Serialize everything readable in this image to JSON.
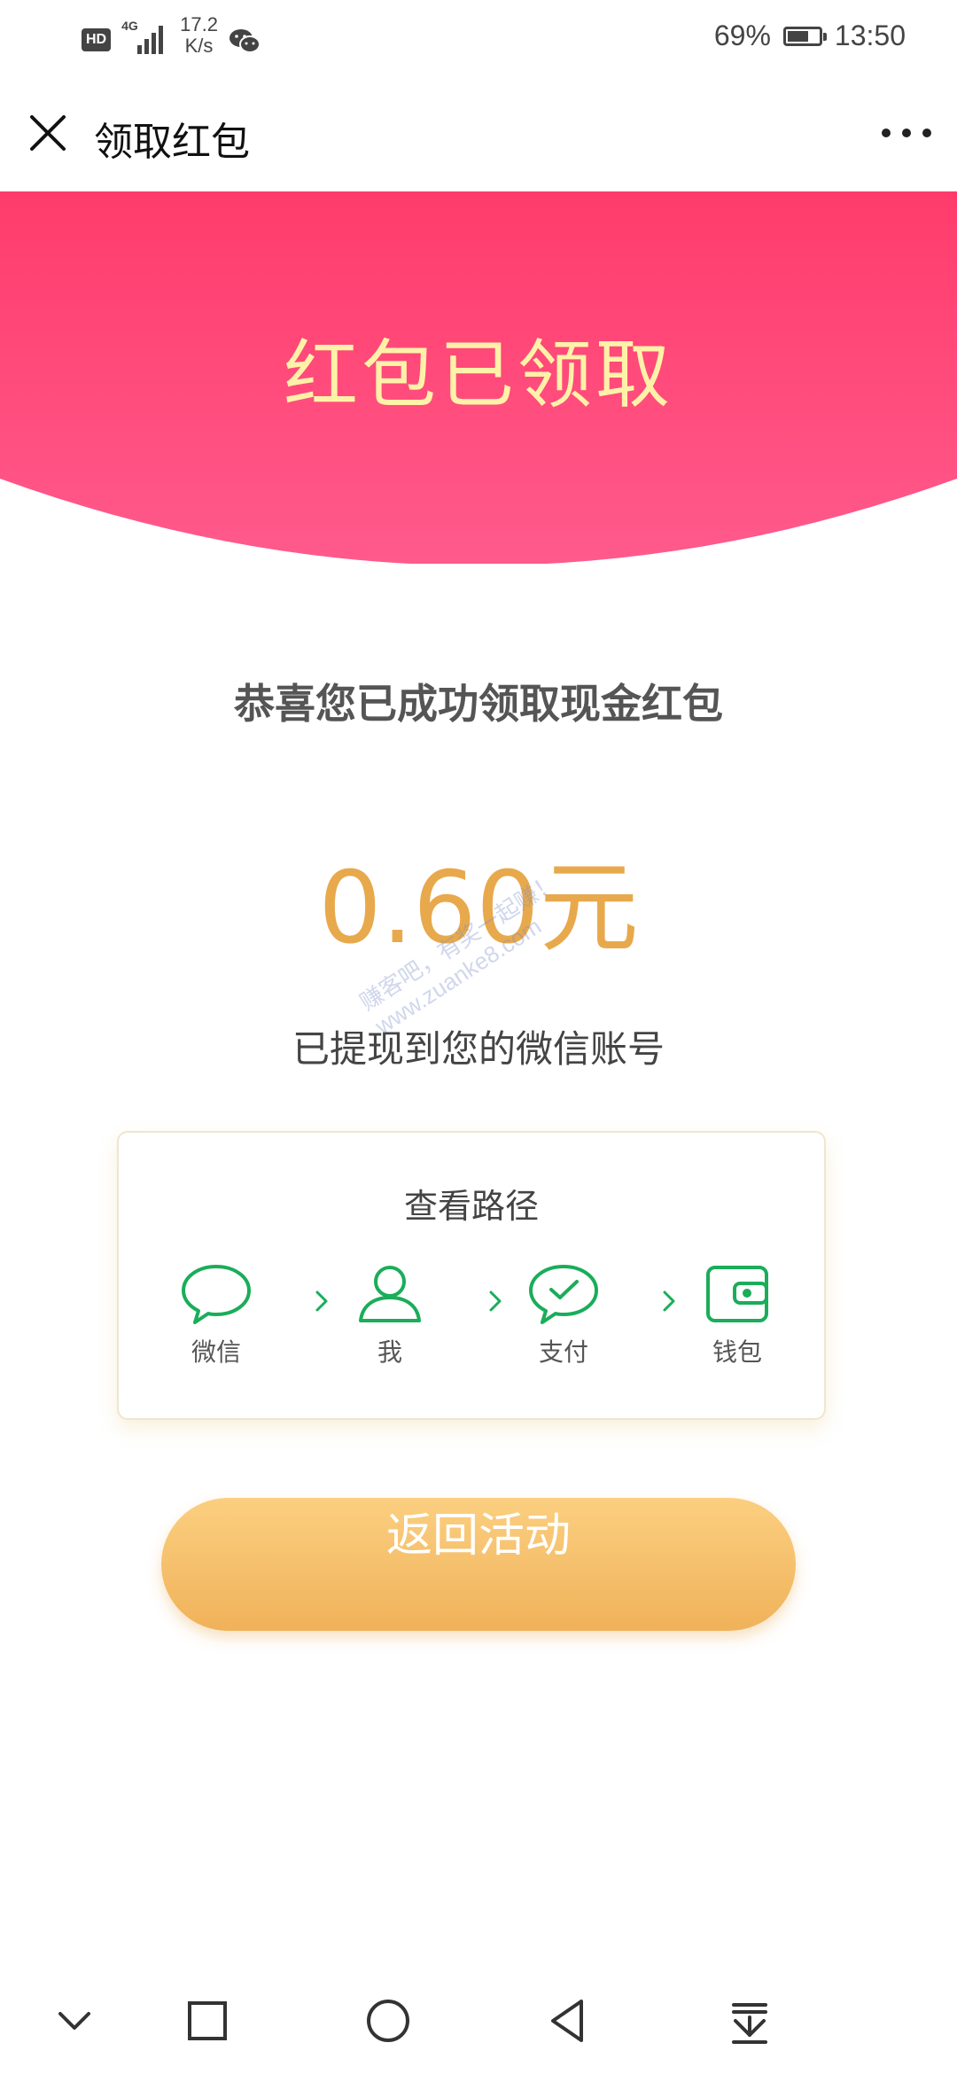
{
  "status_bar": {
    "hd_label": "HD",
    "network_label": "4G",
    "speed_value": "17.2",
    "speed_unit": "K/s",
    "battery_percent": "69%",
    "battery_level": 0.69,
    "time": "13:50"
  },
  "title_bar": {
    "title": "领取红包",
    "close_icon": "close-icon",
    "more_icon": "more-icon"
  },
  "banner": {
    "title": "红包已领取",
    "top_color": "#ff3c6b",
    "bottom_color": "#ff5a8c",
    "text_color": "#fff2a8"
  },
  "main": {
    "success_message": "恭喜您已成功领取现金红包",
    "amount": "0.60元",
    "withdraw_message": "已提现到您的微信账号"
  },
  "path_card": {
    "title": "查看路径",
    "steps": [
      {
        "label": "微信",
        "icon": "chat-bubble-icon"
      },
      {
        "label": "我",
        "icon": "user-icon"
      },
      {
        "label": "支付",
        "icon": "pay-check-icon"
      },
      {
        "label": "钱包",
        "icon": "wallet-icon"
      }
    ],
    "icon_color": "#1aad5a"
  },
  "actions": {
    "return_label": "返回活动"
  },
  "watermark": {
    "line1": "赚客吧，有奖一起赚！",
    "line2": "www.zuanke8.com"
  },
  "nav_bar": {
    "items": [
      "chevron-down-icon",
      "square-icon",
      "circle-icon",
      "back-triangle-icon",
      "notification-down-icon"
    ]
  }
}
